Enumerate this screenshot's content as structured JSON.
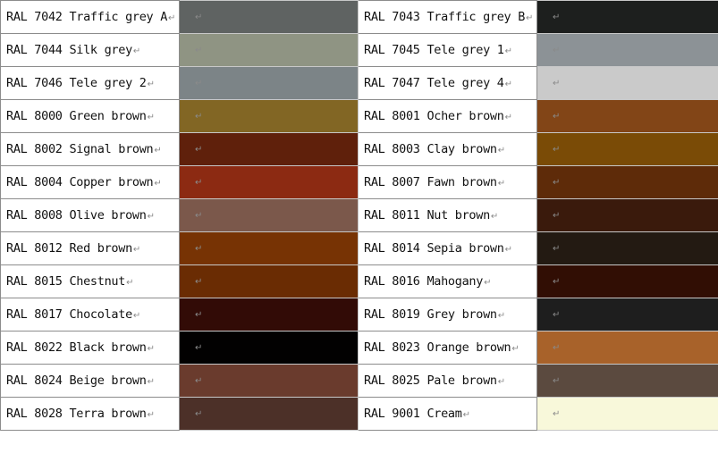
{
  "paragraph_mark": "↵",
  "rows": [
    {
      "left": {
        "label": "RAL 7042 Traffic grey A",
        "color": "#5f6362"
      },
      "right": {
        "label": "RAL 7043 Traffic grey B",
        "color": "#1d1f1e"
      }
    },
    {
      "left": {
        "label": "RAL 7044 Silk grey",
        "color": "#8f9483"
      },
      "right": {
        "label": "RAL 7045 Tele grey 1",
        "color": "#8c9296"
      }
    },
    {
      "left": {
        "label": "RAL 7046 Tele grey 2",
        "color": "#7c8487"
      },
      "right": {
        "label": "RAL 7047 Tele grey 4",
        "color": "#cacaca"
      }
    },
    {
      "left": {
        "label": "RAL 8000 Green brown",
        "color": "#826624"
      },
      "right": {
        "label": "RAL 8001 Ocher brown",
        "color": "#824517"
      }
    },
    {
      "left": {
        "label": "RAL 8002 Signal brown",
        "color": "#5f200b"
      },
      "right": {
        "label": "RAL 8003 Clay brown",
        "color": "#7a4b06"
      }
    },
    {
      "left": {
        "label": "RAL 8004 Copper brown",
        "color": "#8c2a12"
      },
      "right": {
        "label": "RAL 8007 Fawn brown",
        "color": "#5e2b09"
      }
    },
    {
      "left": {
        "label": "RAL 8008 Olive brown",
        "color": "#7b584b"
      },
      "right": {
        "label": "RAL 8011 Nut brown",
        "color": "#3a1a0c"
      }
    },
    {
      "left": {
        "label": "RAL 8012 Red brown",
        "color": "#773304"
      },
      "right": {
        "label": "RAL 8014 Sepia brown",
        "color": "#231a12"
      }
    },
    {
      "left": {
        "label": "RAL 8015 Chestnut",
        "color": "#6a2c03"
      },
      "right": {
        "label": "RAL 8016 Mahogany",
        "color": "#310e04"
      }
    },
    {
      "left": {
        "label": "RAL 8017 Chocolate",
        "color": "#320b06"
      },
      "right": {
        "label": "RAL 8019 Grey brown",
        "color": "#1e1e1e"
      }
    },
    {
      "left": {
        "label": "RAL 8022 Black brown",
        "color": "#020101"
      },
      "right": {
        "label": "RAL 8023 Orange brown",
        "color": "#a8622a"
      }
    },
    {
      "left": {
        "label": "RAL 8024 Beige brown",
        "color": "#6a3b2d"
      },
      "right": {
        "label": "RAL 8025 Pale brown",
        "color": "#5b4a3f"
      }
    },
    {
      "left": {
        "label": "RAL 8028 Terra brown",
        "color": "#4c3028"
      },
      "right": {
        "label": "RAL 9001 Cream",
        "color": "#f8f8da"
      }
    }
  ]
}
